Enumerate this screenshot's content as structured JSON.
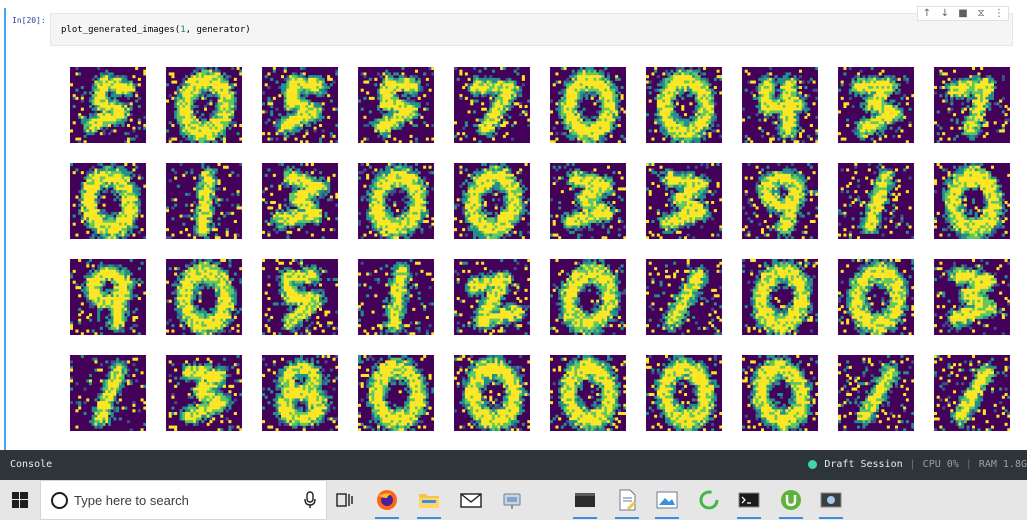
{
  "cell": {
    "prompt": "In[20]:",
    "code": {
      "call": "plot_generated_images(",
      "arg_num": "1",
      "rest": ", generator)"
    },
    "toolbar": [
      "↑",
      "↓",
      "■",
      "⧖",
      "⋮"
    ]
  },
  "output": {
    "colormap": {
      "background": "#44015a",
      "low": "#3b528b",
      "mid": "#21918c",
      "high": "#5ec962",
      "peak": "#fde725"
    },
    "rows": [
      [
        "5",
        "0",
        "5",
        "5",
        "7",
        "0",
        "0",
        "4",
        "3",
        "7"
      ],
      [
        "0",
        "1",
        "3",
        "0",
        "0",
        "3",
        "3",
        "9",
        "1",
        "0"
      ],
      [
        "9",
        "0",
        "5",
        "1",
        "2",
        "0",
        "1",
        "0",
        "0",
        "3"
      ],
      [
        "1",
        "3",
        "8",
        "0",
        "0",
        "0",
        "0",
        "0",
        "1",
        "1"
      ]
    ]
  },
  "console": {
    "label": "Console",
    "session_name": "Draft Session",
    "cpu": "CPU 0%",
    "ram": "RAM 1.8G",
    "session_color": "#42d4a4"
  },
  "taskbar": {
    "search_placeholder": "Type here to search",
    "apps": [
      "task-view-icon",
      "firefox-icon",
      "file-explorer-icon",
      "mail-icon",
      "network-icon",
      "terminal-icon",
      "notepad-icon",
      "image-viewer-icon",
      "loading-ring-icon",
      "command-prompt-icon",
      "utorrent-icon",
      "screenshot-tool-icon"
    ]
  }
}
